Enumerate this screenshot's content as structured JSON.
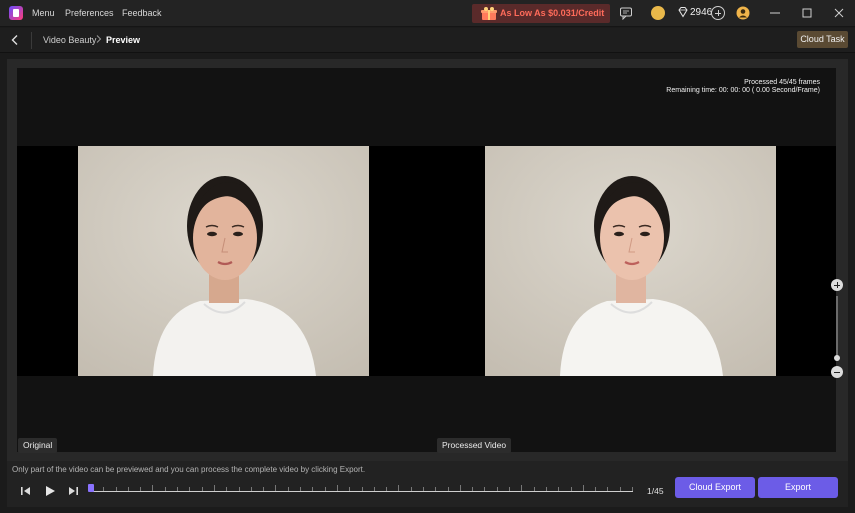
{
  "titlebar": {
    "menu": [
      "Menu",
      "Preferences",
      "Feedback"
    ],
    "promo_text": "As Low As $0.031/Credit",
    "credits": "2946"
  },
  "navbar": {
    "breadcrumb": [
      "Video Beauty",
      "Preview"
    ],
    "cloud_task": "Cloud Task"
  },
  "preview": {
    "status_line1": "Processed 45/45 frames",
    "status_line2": "Remaining time: 00: 00: 00 ( 0.00 Second/Frame)",
    "label_original": "Original",
    "label_processed": "Processed Video"
  },
  "bottombar": {
    "hint": "Only part of the video can be previewed and you can process the complete video by clicking Export.",
    "frame_count": "1/45",
    "playhead_fraction": 0.0,
    "cloud_export": "Cloud Export",
    "export": "Export"
  },
  "colors": {
    "accent": "#6c5ce7",
    "promo": "#ff6b5a",
    "cloud_task_bg": "#5a4a33"
  }
}
